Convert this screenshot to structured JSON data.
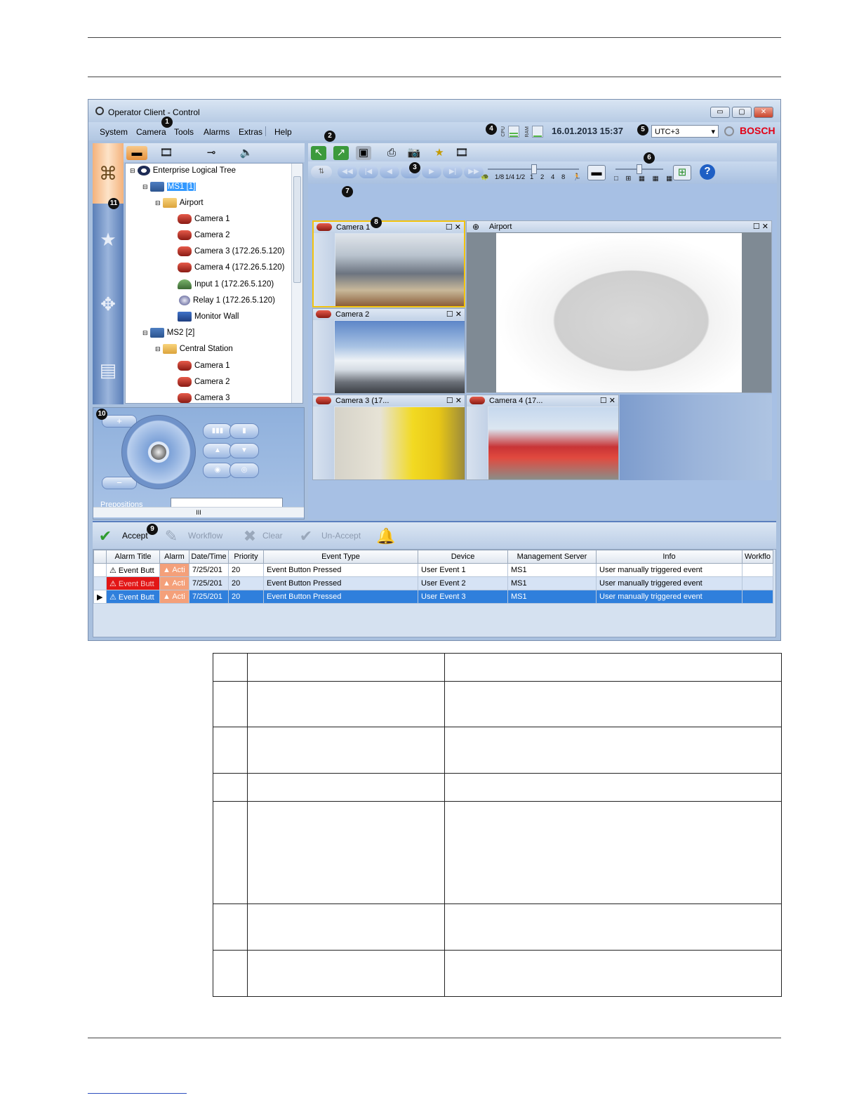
{
  "window": {
    "title": "Operator Client - Control",
    "menu": [
      "System",
      "Camera",
      "Tools",
      "Alarms",
      "Extras",
      "Help"
    ],
    "status": {
      "cpu_label": "CPU",
      "ram_label": "RAM",
      "datetime": "16.01.2013 15:37",
      "timezone": "UTC+3",
      "brand": "BOSCH"
    },
    "controls": {
      "minimize": "▭",
      "maximize": "▢",
      "close": "✕"
    }
  },
  "callouts": [
    "1",
    "2",
    "3",
    "4",
    "5",
    "6",
    "7",
    "8",
    "9",
    "10",
    "11"
  ],
  "tree": {
    "root": "Enterprise Logical Tree",
    "items": [
      {
        "label": "MS1 [1]",
        "icon": "server-icon",
        "selected": true
      },
      {
        "label": "Airport",
        "icon": "map-folder-icon"
      },
      {
        "label": "Camera 1",
        "icon": "ptz-camera-icon"
      },
      {
        "label": "Camera 2",
        "icon": "camera-icon"
      },
      {
        "label": "Camera 3 (172.26.5.120)",
        "icon": "camera-icon"
      },
      {
        "label": "Camera 4 (172.26.5.120)",
        "icon": "camera-icon"
      },
      {
        "label": "Input 1 (172.26.5.120)",
        "icon": "input-icon"
      },
      {
        "label": "Relay 1 (172.26.5.120)",
        "icon": "relay-icon"
      },
      {
        "label": "Monitor Wall",
        "icon": "monitor-wall-icon"
      },
      {
        "label": "MS2 [2]",
        "icon": "server-icon"
      },
      {
        "label": "Central Station",
        "icon": "map-folder-icon"
      },
      {
        "label": "Camera 1",
        "icon": "ptz-camera-icon"
      },
      {
        "label": "Camera 2",
        "icon": "camera-icon"
      },
      {
        "label": "Camera 3",
        "icon": "camera-icon"
      }
    ]
  },
  "ptz": {
    "prepositions_label": "Prepositions",
    "zoom_in": "+",
    "zoom_out": "−",
    "scroll_label": "III"
  },
  "playback": {
    "speeds": [
      "1/8",
      "1/4",
      "1/2",
      "1",
      "2",
      "4",
      "8"
    ]
  },
  "image_windows": [
    {
      "title": "Camera 1",
      "active": true
    },
    {
      "title": "Airport"
    },
    {
      "title": "Camera 2"
    },
    {
      "title": "Camera 3 (17..."
    },
    {
      "title": "Camera 4 (17..."
    }
  ],
  "window_controls": {
    "maximize": "☐",
    "close": "✕"
  },
  "alarm_toolbar": {
    "accept": "Accept",
    "workflow": "Workflow",
    "clear": "Clear",
    "unaccept": "Un-Accept"
  },
  "alarm_list": {
    "columns": [
      "Alarm Title",
      "Alarm",
      "Date/Time",
      "Priority",
      "Event Type",
      "Device",
      "Management Server",
      "Info",
      "Workflo"
    ],
    "rows": [
      {
        "title": "Event Butt",
        "state": "Acti",
        "datetime": "7/25/201",
        "priority": "20",
        "event_type": "Event Button Pressed",
        "device": "User Event 1",
        "server": "MS1",
        "info": "User manually triggered event"
      },
      {
        "title": "Event Butt",
        "state": "Acti",
        "datetime": "7/25/201",
        "priority": "20",
        "event_type": "Event Button Pressed",
        "device": "User Event 2",
        "server": "MS1",
        "info": "User manually triggered event"
      },
      {
        "title": "Event Butt",
        "state": "Acti",
        "datetime": "7/25/201",
        "priority": "20",
        "event_type": "Event Button Pressed",
        "device": "User Event 3",
        "server": "MS1",
        "info": "User manually triggered event"
      }
    ]
  },
  "colors": {
    "accent": "#3399ff",
    "brand": "#e20015",
    "alarm_red": "#e21616",
    "active_frame": "#f3c30e"
  }
}
